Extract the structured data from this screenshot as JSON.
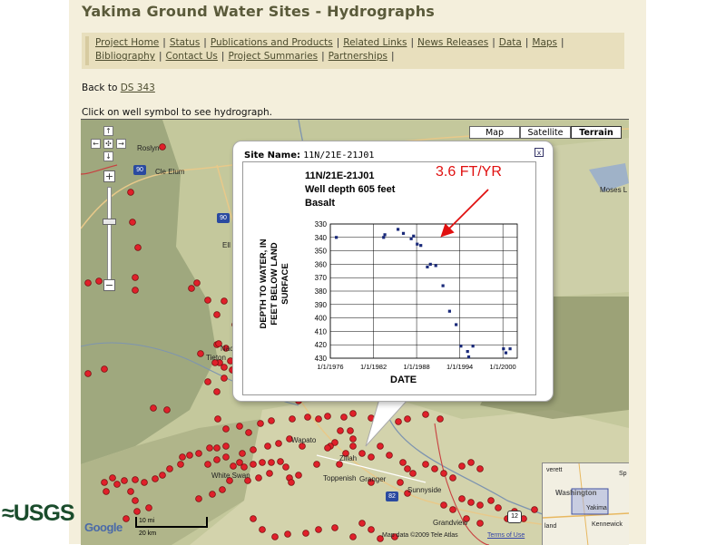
{
  "header": {
    "title": "Yakima Ground Water Sites - Hydrographs"
  },
  "nav": {
    "row1": [
      "Project Home",
      "Status",
      "Publications and Products",
      "Related Links",
      "News Releases",
      "Data",
      "Maps"
    ],
    "row2": [
      "Bibliography",
      "Contact Us",
      "Project Summaries",
      "Partnerships"
    ],
    "separator": "|"
  },
  "back": {
    "prefix": "Back to",
    "link": "DS 343"
  },
  "instruction": "Click on well symbol to see hydrograph.",
  "map_controls": {
    "types": [
      {
        "label": "Map",
        "active": false
      },
      {
        "label": "Satellite",
        "active": false
      },
      {
        "label": "Terrain",
        "active": true
      }
    ],
    "zoom_in": "+",
    "zoom_out": "−"
  },
  "map_labels": {
    "roslyn": "Roslyn",
    "cle_elum": "Cle Elum",
    "moses_lake": "Moses L",
    "nac": "Nac",
    "tieton": "Tieton",
    "ell": "Ell",
    "wapato": "Wapato",
    "zillah": "Zillah",
    "white_swan": "White Swan",
    "toppenish": "Toppenish",
    "granger": "Granger",
    "sunnyside": "Sunnyside",
    "grandview": "Grandview",
    "hwy90a": "90",
    "hwy90b": "90",
    "hwy82": "82",
    "hwy12": "12",
    "scale_mi": "10 mi",
    "scale_km": "20 km",
    "attribution": "Map data ©2009 Tele Atlas",
    "terms": "Terms of Use",
    "google": "Google",
    "overview_washington": "Washington",
    "overview_yakima": "Yakima",
    "overview_kennewick": "Kennewick",
    "overview_everett": "verett",
    "overview_land": "land",
    "overview_sp": "Sp"
  },
  "popup": {
    "site_label": "Site Name:",
    "site_value": "11N/21E-21J01",
    "close": "x",
    "well_id": "11N/21E-21J01",
    "well_depth": "Well depth 605 feet",
    "rock": "Basalt",
    "annotation": "3.6 FT/YR",
    "ylabel_lines": [
      "DEPTH TO WATER, IN",
      "FEET BELOW LAND",
      "SURFACE"
    ],
    "xlabel": "DATE"
  },
  "chart_data": {
    "type": "scatter",
    "title": "",
    "xlabel": "DATE",
    "ylabel": "DEPTH TO WATER, IN FEET BELOW LAND SURFACE",
    "annotation": "3.6 FT/YR",
    "x_ticks": [
      "1/1/1976",
      "1/1/1982",
      "1/1/1988",
      "1/1/1994",
      "1/1/2000"
    ],
    "y_ticks": [
      330,
      340,
      350,
      360,
      370,
      380,
      390,
      400,
      410,
      420,
      430
    ],
    "ylim": [
      330,
      430
    ],
    "y_inverted": true,
    "grid": true,
    "series": [
      {
        "points": [
          {
            "x": "1976-11",
            "y": 340
          },
          {
            "x": "1983-06",
            "y": 340
          },
          {
            "x": "1983-08",
            "y": 338
          },
          {
            "x": "1985-06",
            "y": 334
          },
          {
            "x": "1986-03",
            "y": 337
          },
          {
            "x": "1987-04",
            "y": 341
          },
          {
            "x": "1987-08",
            "y": 339
          },
          {
            "x": "1988-02",
            "y": 345
          },
          {
            "x": "1988-08",
            "y": 346
          },
          {
            "x": "1989-07",
            "y": 362
          },
          {
            "x": "1989-12",
            "y": 360
          },
          {
            "x": "1990-09",
            "y": 361
          },
          {
            "x": "1991-09",
            "y": 376
          },
          {
            "x": "1992-08",
            "y": 395
          },
          {
            "x": "1993-07",
            "y": 405
          },
          {
            "x": "1994-03",
            "y": 421
          },
          {
            "x": "1995-02",
            "y": 425
          },
          {
            "x": "1995-04",
            "y": 429
          },
          {
            "x": "1995-11",
            "y": 421
          },
          {
            "x": "2000-02",
            "y": 423
          },
          {
            "x": "2000-06",
            "y": 426
          },
          {
            "x": "2001-01",
            "y": 423
          }
        ]
      }
    ]
  },
  "logo": {
    "text": "≈USGS"
  }
}
